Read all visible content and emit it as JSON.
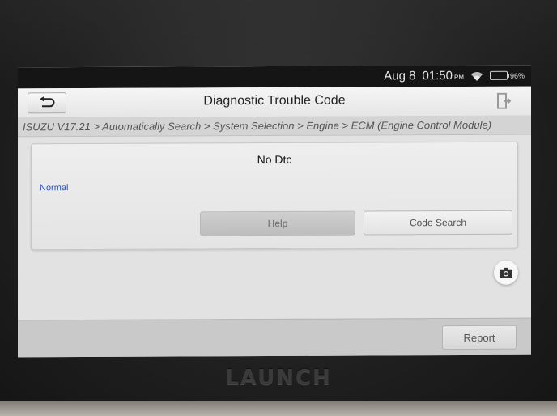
{
  "statusbar": {
    "date": "Aug 8",
    "time": "01:50",
    "ampm": "PM",
    "battery_text": "96%",
    "battery_level": 0.96,
    "wifi_icon": "wifi-icon"
  },
  "titlebar": {
    "title": "Diagnostic Trouble Code",
    "back_icon": "back-arrow-icon",
    "exit_icon": "exit-icon"
  },
  "breadcrumb": "ISUZU V17.21 > Automatically Search > System Selection > Engine > ECM (Engine Control Module)",
  "dtc": {
    "message": "No Dtc",
    "status": "Normal",
    "status_color": "#2a55b8"
  },
  "buttons": {
    "help": "Help",
    "code_search": "Code Search",
    "report": "Report",
    "camera_icon": "camera-icon"
  },
  "brand": "LAUNCH"
}
